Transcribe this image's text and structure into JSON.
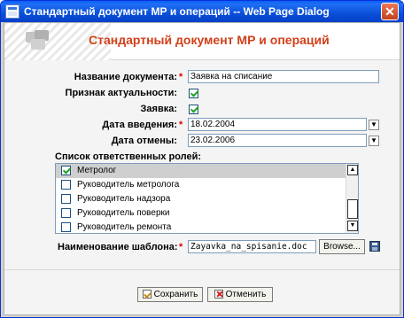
{
  "window": {
    "title": "Стандартный документ МР и операций -- Web Page Dialog",
    "close_symbol": "✕"
  },
  "header": {
    "title": "Стандартный документ МР и операций"
  },
  "form": {
    "required_mark": "*",
    "doc_name": {
      "label": "Название документа:",
      "value": "Заявка на списание"
    },
    "actual": {
      "label": "Признак актуальности:",
      "checked": true
    },
    "request": {
      "label": "Заявка:",
      "checked": true
    },
    "date_in": {
      "label": "Дата введения:",
      "value": "18.02.2004",
      "dropdown_icon": "chevron-down-icon"
    },
    "date_cancel": {
      "label": "Дата отмены:",
      "value": "23.02.2006",
      "dropdown_icon": "chevron-down-icon"
    },
    "roles": {
      "label": "Список ответственных ролей:",
      "items": [
        {
          "label": "Метролог",
          "checked": true,
          "selected": true
        },
        {
          "label": "Руководитель метролога",
          "checked": false,
          "selected": false
        },
        {
          "label": "Руководитель надзора",
          "checked": false,
          "selected": false
        },
        {
          "label": "Руководитель поверки",
          "checked": false,
          "selected": false
        },
        {
          "label": "Руководитель ремонта",
          "checked": false,
          "selected": false
        }
      ],
      "scroll_up": "▲",
      "scroll_down": "▼"
    },
    "template": {
      "label": "Наименование шаблона:",
      "value": "Zayavka_na_spisanie.doc",
      "browse_label": "Browse...",
      "save_icon": "disk-icon"
    }
  },
  "buttons": {
    "save": {
      "label": "Сохранить",
      "icon": "save-icon"
    },
    "cancel": {
      "label": "Отменить",
      "icon": "cancel-icon"
    }
  },
  "colors": {
    "accent": "#d2401a",
    "titlebar": "#0a4fd8",
    "required": "#e00000"
  }
}
